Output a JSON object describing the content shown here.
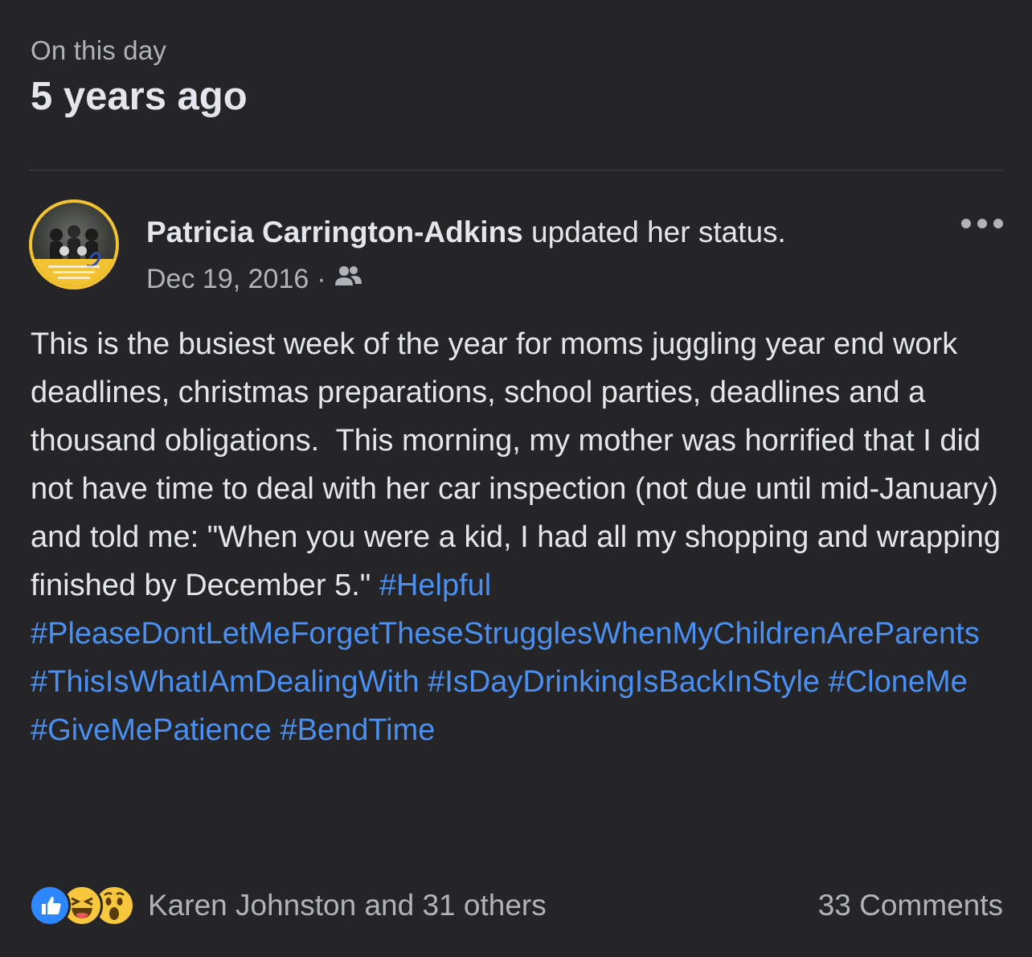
{
  "memory": {
    "kicker": "On this day",
    "headline": "5 years ago"
  },
  "post": {
    "author": "Patricia Carrington-Adkins",
    "action": " updated her status.",
    "date": "Dec 19, 2016",
    "separator": "·",
    "audience_icon": "friends-icon",
    "body_text": "This is the busiest week of the year for moms juggling year end work deadlines, christmas preparations, school parties, deadlines and a thousand obligations.  This morning, my mother was horrified that I did not have time to deal with her car inspection (not due until mid-January) and told me: \"When you were a kid, I had all my shopping and wrapping finished by December 5.\" ",
    "hashtags": [
      "#Helpful",
      "#PleaseDontLetMeForgetTheseStrugglesWhenMyChildrenAreParents",
      "#ThisIsWhatIAmDealingWith",
      "#IsDayDrinkingIsBackInStyle",
      "#CloneMe",
      "#GiveMePatience",
      "#BendTime"
    ]
  },
  "footer": {
    "reactions": [
      "like-icon",
      "haha-icon",
      "wow-icon"
    ],
    "reaction_summary": "Karen Johnston and 31 others",
    "comments": "33 Comments"
  },
  "colors": {
    "background": "#252527",
    "hashtag": "#4b8ff0",
    "like": "#2d88ff",
    "emoji": "#f7c83e",
    "avatar_ring": "#f2c230"
  }
}
